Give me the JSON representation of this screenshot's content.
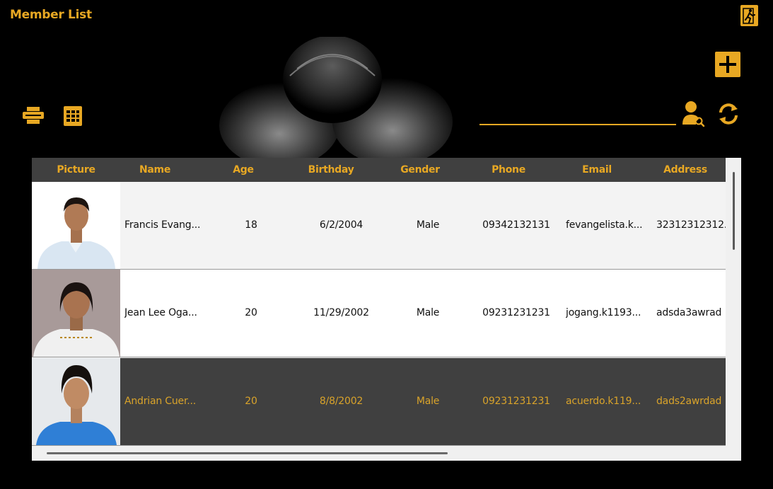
{
  "window": {
    "title": "Member List"
  },
  "toolbar": {
    "exit_icon": "exit-run-icon",
    "add_icon": "plus-icon",
    "print_icon": "printer-icon",
    "excel_icon": "spreadsheet-icon",
    "search_user_icon": "user-search-icon",
    "refresh_icon": "refresh-icon"
  },
  "search": {
    "value": "",
    "placeholder": ""
  },
  "colors": {
    "accent": "#e8a823",
    "header_bg": "#404040",
    "selected_bg": "#404040",
    "background": "#000000"
  },
  "table": {
    "columns": [
      "Picture",
      "Name",
      "Age",
      "Birthday",
      "Gender",
      "Phone",
      "Email",
      "Address"
    ],
    "rows": [
      {
        "name": "Francis Evang...",
        "age": "18",
        "birthday": "6/2/2004",
        "gender": "Male",
        "phone": "09342132131",
        "email": "fevangelista.k...",
        "address": "32312312312..."
      },
      {
        "name": "Jean Lee Oga...",
        "age": "20",
        "birthday": "11/29/2002",
        "gender": "Male",
        "phone": "09231231231",
        "email": "jogang.k1193...",
        "address": "adsda3awrad"
      },
      {
        "name": "Andrian Cuer...",
        "age": "20",
        "birthday": "8/8/2002",
        "gender": "Male",
        "phone": "09231231231",
        "email": "acuerdo.k119...",
        "address": "dads2awrdad"
      }
    ],
    "selected_row": 2
  }
}
